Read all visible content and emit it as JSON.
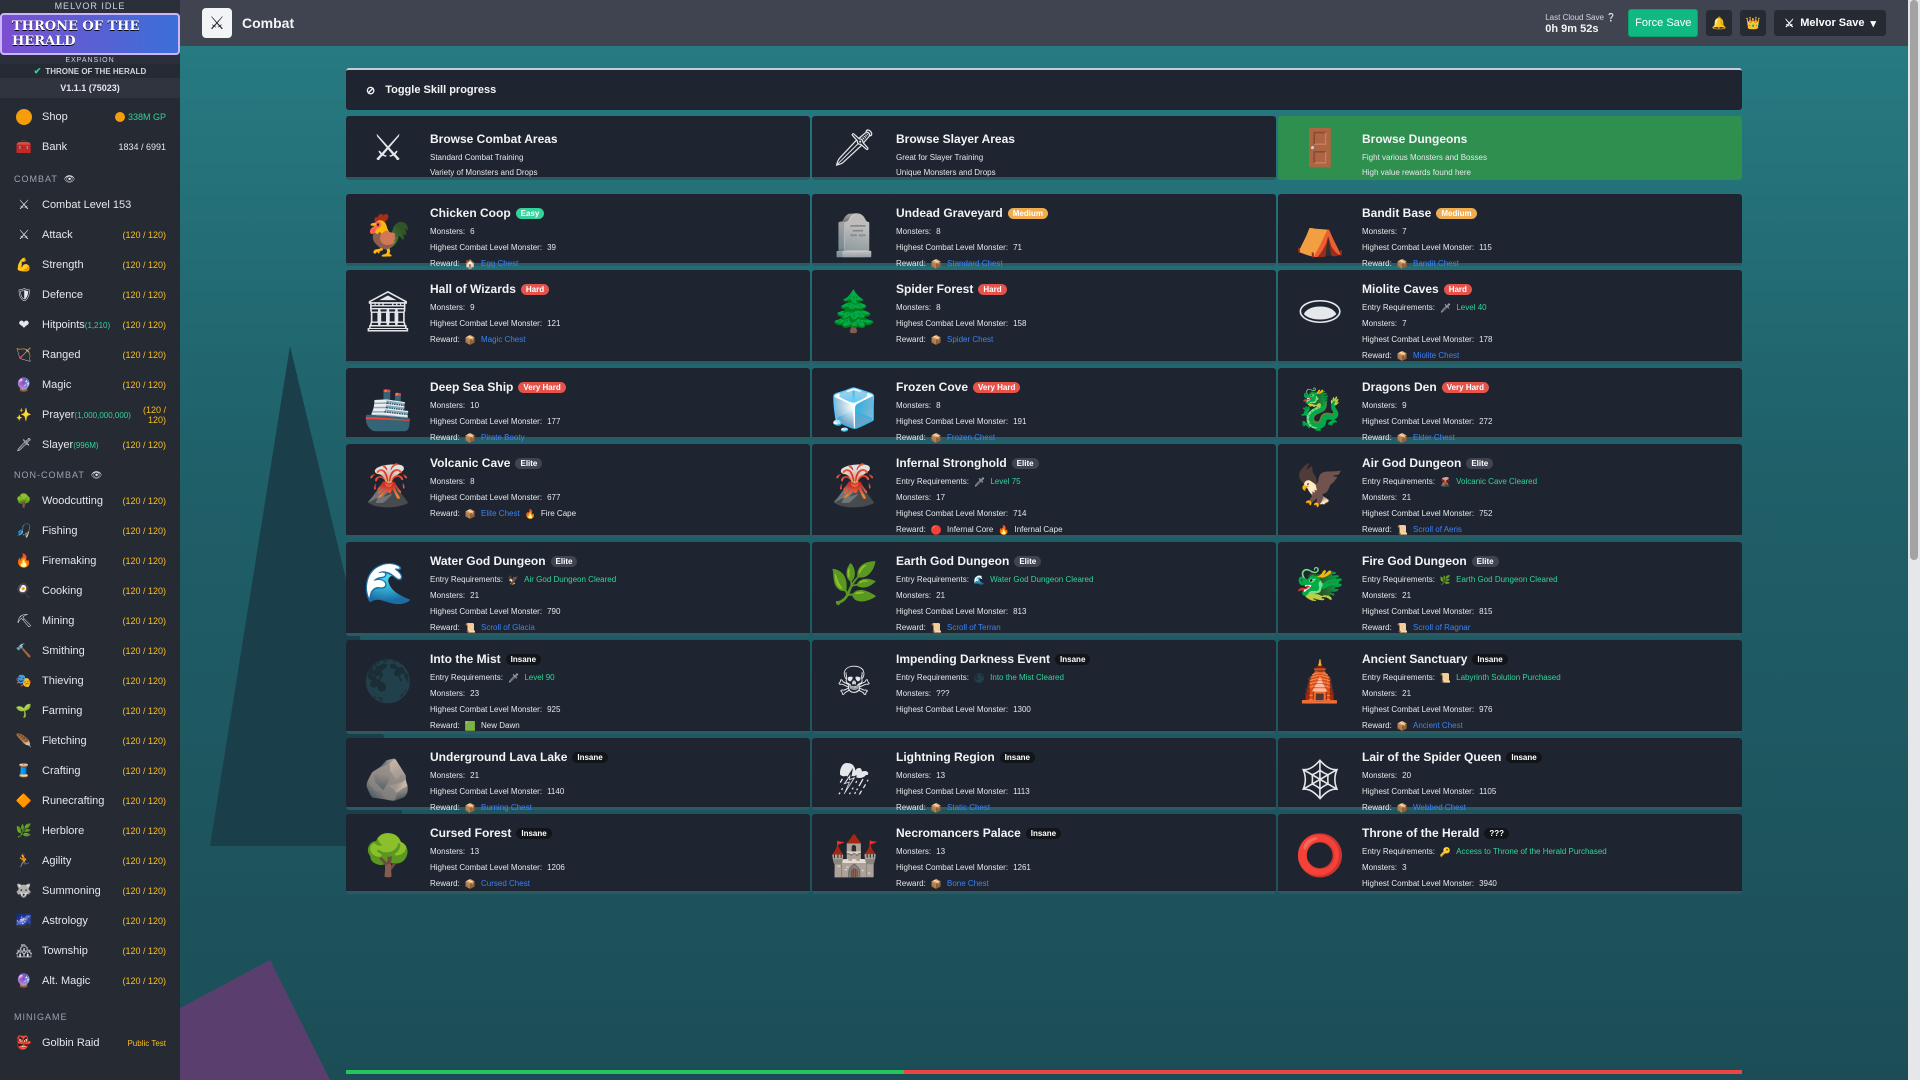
{
  "sidebar": {
    "logo_small": "MELVOR IDLE",
    "logo_big": "THRONE OF THE HERALD",
    "logo_exp": "EXPANSION",
    "expansion_label": "THRONE OF THE HERALD",
    "version": "V1.1.1 (75023)",
    "shop": {
      "label": "Shop",
      "gp": "338M GP"
    },
    "bank": {
      "label": "Bank",
      "count": "1834 / 6991"
    },
    "combat_header": "COMBAT",
    "combat_level": "Combat Level 153",
    "combat_skills": [
      {
        "label": "Attack",
        "level": "(120 / 120)",
        "icon": "⚔",
        "extra": ""
      },
      {
        "label": "Strength",
        "level": "(120 / 120)",
        "icon": "💪",
        "extra": ""
      },
      {
        "label": "Defence",
        "level": "(120 / 120)",
        "icon": "🛡",
        "extra": ""
      },
      {
        "label": "Hitpoints",
        "level": "(120 / 120)",
        "icon": "❤",
        "extra": "(1,210)"
      },
      {
        "label": "Ranged",
        "level": "(120 / 120)",
        "icon": "🏹",
        "extra": ""
      },
      {
        "label": "Magic",
        "level": "(120 / 120)",
        "icon": "🔮",
        "extra": ""
      },
      {
        "label": "Prayer",
        "level": "(120 / 120)",
        "icon": "✨",
        "extra": "(1,000,000,000)"
      },
      {
        "label": "Slayer",
        "level": "(120 / 120)",
        "icon": "🗡",
        "extra": "(996M)"
      }
    ],
    "noncombat_header": "NON-COMBAT",
    "noncombat_skills": [
      {
        "label": "Woodcutting",
        "level": "(120 / 120)",
        "icon": "🌳"
      },
      {
        "label": "Fishing",
        "level": "(120 / 120)",
        "icon": "🎣"
      },
      {
        "label": "Firemaking",
        "level": "(120 / 120)",
        "icon": "🔥"
      },
      {
        "label": "Cooking",
        "level": "(120 / 120)",
        "icon": "🍳"
      },
      {
        "label": "Mining",
        "level": "(120 / 120)",
        "icon": "⛏"
      },
      {
        "label": "Smithing",
        "level": "(120 / 120)",
        "icon": "🔨"
      },
      {
        "label": "Thieving",
        "level": "(120 / 120)",
        "icon": "🎭"
      },
      {
        "label": "Farming",
        "level": "(120 / 120)",
        "icon": "🌱"
      },
      {
        "label": "Fletching",
        "level": "(120 / 120)",
        "icon": "🪶"
      },
      {
        "label": "Crafting",
        "level": "(120 / 120)",
        "icon": "🧵"
      },
      {
        "label": "Runecrafting",
        "level": "(120 / 120)",
        "icon": "🔶"
      },
      {
        "label": "Herblore",
        "level": "(120 / 120)",
        "icon": "🌿"
      },
      {
        "label": "Agility",
        "level": "(120 / 120)",
        "icon": "🏃"
      },
      {
        "label": "Summoning",
        "level": "(120 / 120)",
        "icon": "🐺"
      },
      {
        "label": "Astrology",
        "level": "(120 / 120)",
        "icon": "🌌"
      },
      {
        "label": "Township",
        "level": "(120 / 120)",
        "icon": "🏘"
      },
      {
        "label": "Alt. Magic",
        "level": "(120 / 120)",
        "icon": "🔮"
      }
    ],
    "minigame_header": "MINIGAME",
    "golbin": {
      "label": "Golbin Raid",
      "extra": "Public Test"
    }
  },
  "topbar": {
    "title": "Combat",
    "cloud_label": "Last Cloud Save",
    "cloud_time": "0h 9m 52s",
    "force_save": "Force Save",
    "save_name": "Melvor Save"
  },
  "toggle_label": "Toggle Skill progress",
  "categories": [
    {
      "title": "Browse Combat Areas",
      "l1": "Standard Combat Training",
      "l2": "Variety of Monsters and Drops",
      "icon": "⚔"
    },
    {
      "title": "Browse Slayer Areas",
      "l1": "Great for Slayer Training",
      "l2": "Unique Monsters and Drops",
      "icon": "🗡"
    },
    {
      "title": "Browse Dungeons",
      "l1": "Fight various Monsters and Bosses",
      "l2": "High value rewards found here",
      "icon": "🚪"
    }
  ],
  "labels": {
    "monsters": "Monsters:",
    "highest": "Highest Combat Level Monster:",
    "reward": "Reward:",
    "entry": "Entry Requirements:"
  },
  "dungeons": [
    {
      "name": "Chicken Coop",
      "badge": "Easy",
      "bclass": "b-easy",
      "icon": "🐓",
      "entry": "",
      "entry_icon": "",
      "monsters": "6",
      "highest": "39",
      "rewards": [
        {
          "icon": "🏠",
          "text": "Egg Chest",
          "link": true
        }
      ]
    },
    {
      "name": "Undead Graveyard",
      "badge": "Medium",
      "bclass": "b-medium",
      "icon": "🪦",
      "entry": "",
      "entry_icon": "",
      "monsters": "8",
      "highest": "71",
      "rewards": [
        {
          "icon": "📦",
          "text": "Standard Chest",
          "link": true
        }
      ]
    },
    {
      "name": "Bandit Base",
      "badge": "Medium",
      "bclass": "b-medium",
      "icon": "⛺",
      "entry": "",
      "entry_icon": "",
      "monsters": "7",
      "highest": "115",
      "rewards": [
        {
          "icon": "📦",
          "text": "Bandit Chest",
          "link": true
        }
      ]
    },
    {
      "name": "Hall of Wizards",
      "badge": "Hard",
      "bclass": "b-hard",
      "icon": "🏛",
      "entry": "",
      "entry_icon": "",
      "monsters": "9",
      "highest": "121",
      "rewards": [
        {
          "icon": "📦",
          "text": "Magic Chest",
          "link": true
        }
      ]
    },
    {
      "name": "Spider Forest",
      "badge": "Hard",
      "bclass": "b-hard",
      "icon": "🌲",
      "entry": "",
      "entry_icon": "",
      "monsters": "8",
      "highest": "158",
      "rewards": [
        {
          "icon": "📦",
          "text": "Spider Chest",
          "link": true
        }
      ]
    },
    {
      "name": "Miolite Caves",
      "badge": "Hard",
      "bclass": "b-hard",
      "icon": "🕳",
      "entry": "Level 40",
      "entry_icon": "🗡",
      "monsters": "7",
      "highest": "178",
      "rewards": [
        {
          "icon": "📦",
          "text": "Miolite Chest",
          "link": true
        }
      ]
    },
    {
      "name": "Deep Sea Ship",
      "badge": "Very Hard",
      "bclass": "b-vhard",
      "icon": "🚢",
      "entry": "",
      "entry_icon": "",
      "monsters": "10",
      "highest": "177",
      "rewards": [
        {
          "icon": "📦",
          "text": "Pirate Booty",
          "link": true
        }
      ]
    },
    {
      "name": "Frozen Cove",
      "badge": "Very Hard",
      "bclass": "b-vhard",
      "icon": "🧊",
      "entry": "",
      "entry_icon": "",
      "monsters": "8",
      "highest": "191",
      "rewards": [
        {
          "icon": "📦",
          "text": "Frozen Chest",
          "link": true
        }
      ]
    },
    {
      "name": "Dragons Den",
      "badge": "Very Hard",
      "bclass": "b-vhard",
      "icon": "🐉",
      "entry": "",
      "entry_icon": "",
      "monsters": "9",
      "highest": "272",
      "rewards": [
        {
          "icon": "📦",
          "text": "Elder Chest",
          "link": true
        }
      ]
    },
    {
      "name": "Volcanic Cave",
      "badge": "Elite",
      "bclass": "b-elite",
      "icon": "🌋",
      "entry": "",
      "entry_icon": "",
      "monsters": "8",
      "highest": "677",
      "rewards": [
        {
          "icon": "📦",
          "text": "Elite Chest",
          "link": true
        },
        {
          "icon": "🔥",
          "text": "Fire Cape",
          "link": false
        }
      ]
    },
    {
      "name": "Infernal Stronghold",
      "badge": "Elite",
      "bclass": "b-elite",
      "icon": "🌋",
      "entry": "Level 75",
      "entry_icon": "🗡",
      "monsters": "17",
      "highest": "714",
      "rewards": [
        {
          "icon": "🔴",
          "text": "Infernal Core",
          "link": false
        },
        {
          "icon": "🔥",
          "text": "Infernal Cape",
          "link": false
        }
      ]
    },
    {
      "name": "Air God Dungeon",
      "badge": "Elite",
      "bclass": "b-elite",
      "icon": "🦅",
      "entry": "Volcanic Cave Cleared",
      "entry_icon": "🌋",
      "monsters": "21",
      "highest": "752",
      "rewards": [
        {
          "icon": "📜",
          "text": "Scroll of Aeris",
          "link": true
        }
      ]
    },
    {
      "name": "Water God Dungeon",
      "badge": "Elite",
      "bclass": "b-elite",
      "icon": "🌊",
      "entry": "Air God Dungeon Cleared",
      "entry_icon": "🦅",
      "monsters": "21",
      "highest": "790",
      "rewards": [
        {
          "icon": "📜",
          "text": "Scroll of Glacia",
          "link": true
        }
      ]
    },
    {
      "name": "Earth God Dungeon",
      "badge": "Elite",
      "bclass": "b-elite",
      "icon": "🌿",
      "entry": "Water God Dungeon Cleared",
      "entry_icon": "🌊",
      "monsters": "21",
      "highest": "813",
      "rewards": [
        {
          "icon": "📜",
          "text": "Scroll of Terran",
          "link": true
        }
      ]
    },
    {
      "name": "Fire God Dungeon",
      "badge": "Elite",
      "bclass": "b-elite",
      "icon": "🐲",
      "entry": "Earth God Dungeon Cleared",
      "entry_icon": "🌿",
      "monsters": "21",
      "highest": "815",
      "rewards": [
        {
          "icon": "📜",
          "text": "Scroll of Ragnar",
          "link": true
        }
      ]
    },
    {
      "name": "Into the Mist",
      "badge": "Insane",
      "bclass": "b-insane",
      "icon": "🌑",
      "entry": "Level 90",
      "entry_icon": "🗡",
      "monsters": "23",
      "highest": "925",
      "rewards": [
        {
          "icon": "🟩",
          "text": "New Dawn",
          "link": false
        }
      ]
    },
    {
      "name": "Impending Darkness Event",
      "badge": "Insane",
      "bclass": "b-insane",
      "icon": "☠",
      "entry": "Into the Mist Cleared",
      "entry_icon": "🌑",
      "monsters": "???",
      "highest": "1300",
      "rewards": []
    },
    {
      "name": "Ancient Sanctuary",
      "badge": "Insane",
      "bclass": "b-insane",
      "icon": "🛕",
      "entry": "Labyrinth Solution Purchased",
      "entry_icon": "📜",
      "monsters": "21",
      "highest": "976",
      "rewards": [
        {
          "icon": "📦",
          "text": "Ancient Chest",
          "link": true
        }
      ]
    },
    {
      "name": "Underground Lava Lake",
      "badge": "Insane",
      "bclass": "b-insane",
      "icon": "🪨",
      "entry": "",
      "entry_icon": "",
      "monsters": "21",
      "highest": "1140",
      "rewards": [
        {
          "icon": "📦",
          "text": "Burning Chest",
          "link": true
        }
      ]
    },
    {
      "name": "Lightning Region",
      "badge": "Insane",
      "bclass": "b-insane",
      "icon": "⛈",
      "entry": "",
      "entry_icon": "",
      "monsters": "13",
      "highest": "1113",
      "rewards": [
        {
          "icon": "📦",
          "text": "Static Chest",
          "link": true
        }
      ]
    },
    {
      "name": "Lair of the Spider Queen",
      "badge": "Insane",
      "bclass": "b-insane",
      "icon": "🕸",
      "entry": "",
      "entry_icon": "",
      "monsters": "20",
      "highest": "1105",
      "rewards": [
        {
          "icon": "📦",
          "text": "Webbed Chest",
          "link": true
        }
      ]
    },
    {
      "name": "Cursed Forest",
      "badge": "Insane",
      "bclass": "b-insane",
      "icon": "🌳",
      "entry": "",
      "entry_icon": "",
      "monsters": "13",
      "highest": "1206",
      "rewards": [
        {
          "icon": "📦",
          "text": "Cursed Chest",
          "link": true
        }
      ]
    },
    {
      "name": "Necromancers Palace",
      "badge": "Insane",
      "bclass": "b-insane",
      "icon": "🏰",
      "entry": "",
      "entry_icon": "",
      "monsters": "13",
      "highest": "1261",
      "rewards": [
        {
          "icon": "📦",
          "text": "Bone Chest",
          "link": true
        }
      ]
    },
    {
      "name": "Throne of the Herald",
      "badge": "???",
      "bclass": "b-unk",
      "icon": "⭕",
      "entry": "Access to Throne of the Herald Purchased",
      "entry_icon": "🔑",
      "monsters": "3",
      "highest": "3940",
      "rewards": []
    }
  ],
  "bottom_progress": 0.4
}
